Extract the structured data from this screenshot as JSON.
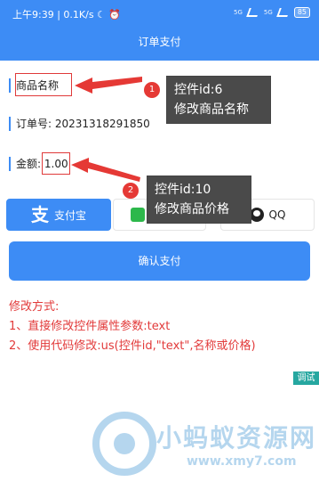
{
  "status_bar": {
    "time_net": "上午9:39 | 0.1K/s",
    "network_1": "5G",
    "network_2": "5G",
    "battery": "85"
  },
  "header": {
    "title": "订单支付"
  },
  "fields": {
    "product_name_label": "商品名称",
    "order_no_label": "订单号:",
    "order_no_value": "20231318291850",
    "amount_label": "金额:",
    "amount_value": "1.00"
  },
  "annotations": [
    {
      "badge": "1",
      "line1": "控件id:6",
      "line2": "修改商品名称"
    },
    {
      "badge": "2",
      "line1": "控件id:10",
      "line2": "修改商品价格"
    }
  ],
  "payment": {
    "alipay_icon": "支",
    "alipay_label": "支付宝",
    "qq_label": "QQ"
  },
  "confirm_label": "确认支付",
  "instructions": {
    "heading": "修改方式:",
    "step1": "1、直接修改控件属性参数:text",
    "step2": "2、使用代码修改:us(控件id,\"text\",名称或价格)"
  },
  "debug_label": "调试",
  "watermark": {
    "text": "小蚂蚁资源网",
    "url": "www.xmy7.com"
  },
  "colors": {
    "primary": "#3d8cf5",
    "annotation_red": "#e53935",
    "instruction_red": "#e23a3a"
  },
  "icons": [
    "alarm-icon",
    "moon-icon",
    "signal-icon",
    "battery-icon",
    "alipay-icon",
    "wechat-icon",
    "qq-icon"
  ]
}
